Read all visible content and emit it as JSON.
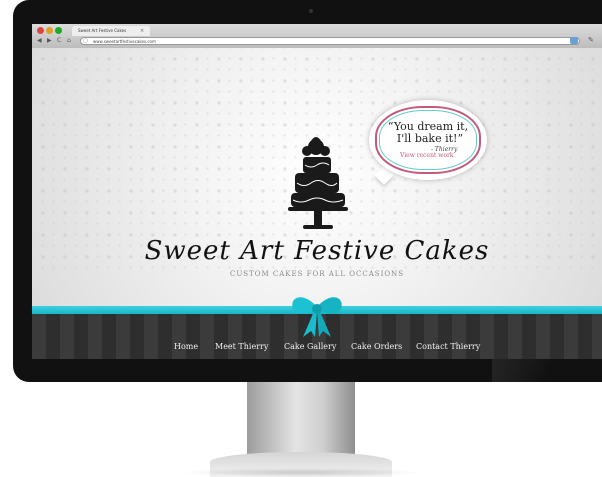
{
  "browser": {
    "tab_title": "Sweet Art Festive Cakes",
    "tab_close": "×",
    "url": "www.sweetartfestivecakes.com",
    "back": "◀",
    "forward": "▶",
    "reload": "C",
    "home": "⌂",
    "wrench": "✎"
  },
  "hero": {
    "quote_line1": "“You dream it,",
    "quote_line2": "I'll bake it!”",
    "signature": "- Thierry",
    "view_recent_work": "View recent work",
    "logo": "Sweet Art Festive Cakes",
    "tagline": "CUSTOM CAKES FOR ALL OCCASIONS"
  },
  "nav": {
    "items": [
      {
        "label": "Home"
      },
      {
        "label": "Meet Thierry"
      },
      {
        "label": "Cake Gallery"
      },
      {
        "label": "Cake Orders"
      },
      {
        "label": "Contact Thierry"
      }
    ]
  },
  "colors": {
    "accent_pink": "#c25a7b",
    "ribbon_teal": "#1ec3d3",
    "nav_dark": "#333333"
  }
}
